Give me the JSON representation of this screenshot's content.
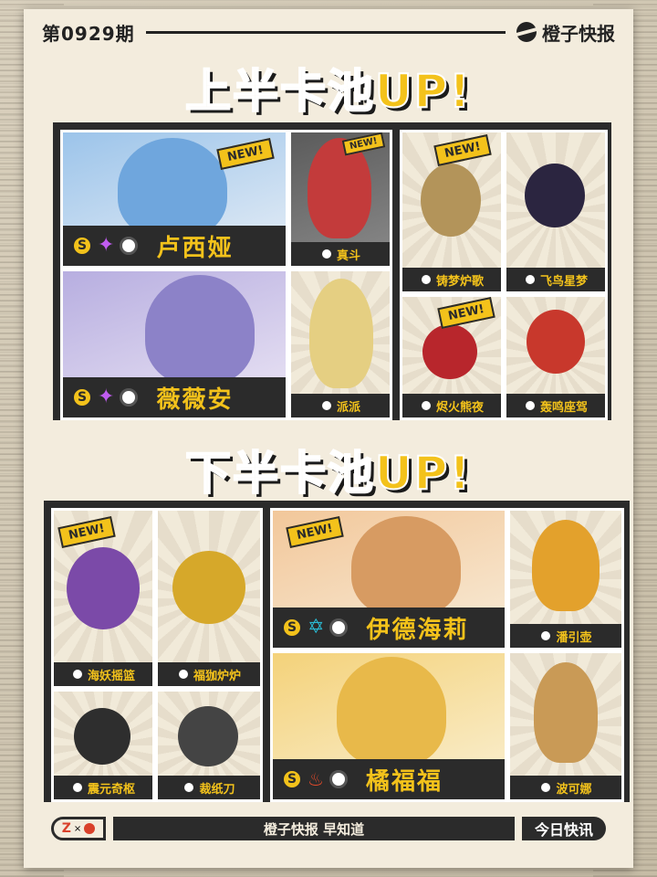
{
  "header": {
    "issue": "第0929期",
    "brand": "橙子快报"
  },
  "upper": {
    "title_main": "上半卡池",
    "title_up": "UP!",
    "new_badge": "NEW!",
    "big_agents": [
      {
        "name": "卢西娅",
        "rank": "S",
        "colors": {
          "bg": "#9cc4ea"
        }
      },
      {
        "name": "薇薇安",
        "rank": "S",
        "colors": {
          "bg": "#b7aee0"
        }
      }
    ],
    "small_agents": [
      {
        "name": "真斗"
      },
      {
        "name": "派派"
      }
    ],
    "engines": [
      {
        "name": "铸梦炉歌"
      },
      {
        "name": "飞鸟星梦"
      },
      {
        "name": "烬火熊夜"
      },
      {
        "name": "轰鸣座驾"
      }
    ]
  },
  "lower": {
    "title_main": "下半卡池",
    "title_up": "UP!",
    "new_badge": "NEW!",
    "big_agents": [
      {
        "name": "伊德海莉",
        "rank": "S"
      },
      {
        "name": "橘福福",
        "rank": "S"
      }
    ],
    "small_agents": [
      {
        "name": "潘引壶"
      },
      {
        "name": "波可娜"
      }
    ],
    "engines": [
      {
        "name": "海妖摇篮"
      },
      {
        "name": "福㹢炉炉"
      },
      {
        "name": "震元奇枢"
      },
      {
        "name": "裁纸刀"
      }
    ]
  },
  "footer": {
    "logo_text": "Z",
    "sep": "×",
    "middle": "橙子快报 早知道",
    "right": "今日快讯"
  }
}
